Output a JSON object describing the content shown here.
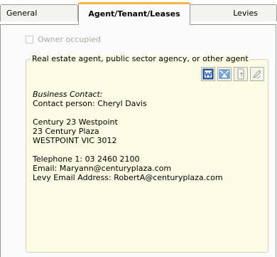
{
  "tabs": [
    {
      "label": "General"
    },
    {
      "label": "Agent/Tenant/Leases"
    },
    {
      "label": "Levies"
    }
  ],
  "owner_occupied": {
    "label": "Owner occupied",
    "checked": false,
    "disabled": true
  },
  "agent_group": {
    "legend": "Real estate agent, public sector agency, or other agent",
    "toolbar_icons": [
      "word-document-icon",
      "envelope-icon",
      "document-icon",
      "edit-icon"
    ],
    "business_contact_heading": "Business Contact:",
    "contact_person": "Contact person: Cheryl Davis",
    "address": [
      "Century 23 Westpoint",
      "23 Century Plaza",
      "WESTPOINT  VIC  3012"
    ],
    "telephone": "Telephone 1: 03 2460 2100",
    "email": "Email: Maryann@centuryplaza.com",
    "levy_email": "Levy Email Address: RobertA@centuryplaza.com"
  },
  "colors": {
    "tab_highlight": "#f7b64c",
    "group_background": "#fdfde6"
  }
}
